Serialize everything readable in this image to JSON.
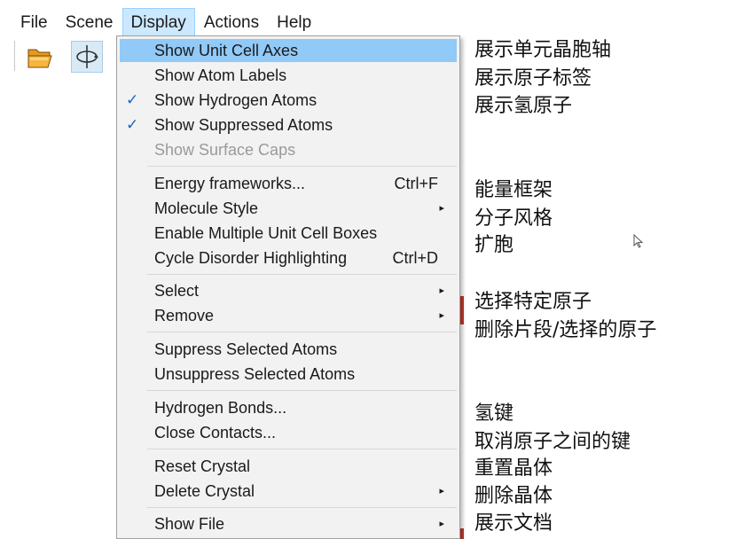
{
  "menubar": {
    "items": [
      {
        "label": "File"
      },
      {
        "label": "Scene"
      },
      {
        "label": "Display"
      },
      {
        "label": "Actions"
      },
      {
        "label": "Help"
      }
    ]
  },
  "display_menu": {
    "items": [
      {
        "label": "Show Unit Cell Axes",
        "checked": false,
        "highlighted": true
      },
      {
        "label": "Show Atom Labels",
        "checked": false
      },
      {
        "label": "Show Hydrogen Atoms",
        "checked": true
      },
      {
        "label": "Show Suppressed Atoms",
        "checked": true
      },
      {
        "label": "Show Surface Caps",
        "disabled": true
      },
      {
        "label": "Energy frameworks...",
        "shortcut": "Ctrl+F"
      },
      {
        "label": "Molecule Style",
        "submenu": true
      },
      {
        "label": "Enable Multiple Unit Cell Boxes"
      },
      {
        "label": "Cycle Disorder Highlighting",
        "shortcut": "Ctrl+D"
      },
      {
        "label": "Select",
        "submenu": true
      },
      {
        "label": "Remove",
        "submenu": true
      },
      {
        "label": "Suppress Selected Atoms"
      },
      {
        "label": "Unsuppress Selected Atoms"
      },
      {
        "label": "Hydrogen Bonds..."
      },
      {
        "label": "Close Contacts..."
      },
      {
        "label": "Reset Crystal"
      },
      {
        "label": "Delete Crystal",
        "submenu": true
      },
      {
        "label": "Show File",
        "submenu": true
      }
    ],
    "check_glyph": "✓",
    "arrow_glyph": "▸"
  },
  "notes": [
    "展示单元晶胞轴",
    "展示原子标签",
    "展示氢原子",
    "能量框架",
    "分子风格",
    "扩胞",
    "选择特定原子",
    "删除片段/选择的原子",
    "氢键",
    "取消原子之间的键",
    "重置晶体",
    "删除晶体",
    "展示文档"
  ],
  "toolbar": {
    "icons": [
      "open-folder-icon",
      "rotate-axes-icon"
    ]
  },
  "colors": {
    "menu_highlight": "#91c9f7",
    "menubar_active": "#cce8ff",
    "check": "#1565c0"
  }
}
